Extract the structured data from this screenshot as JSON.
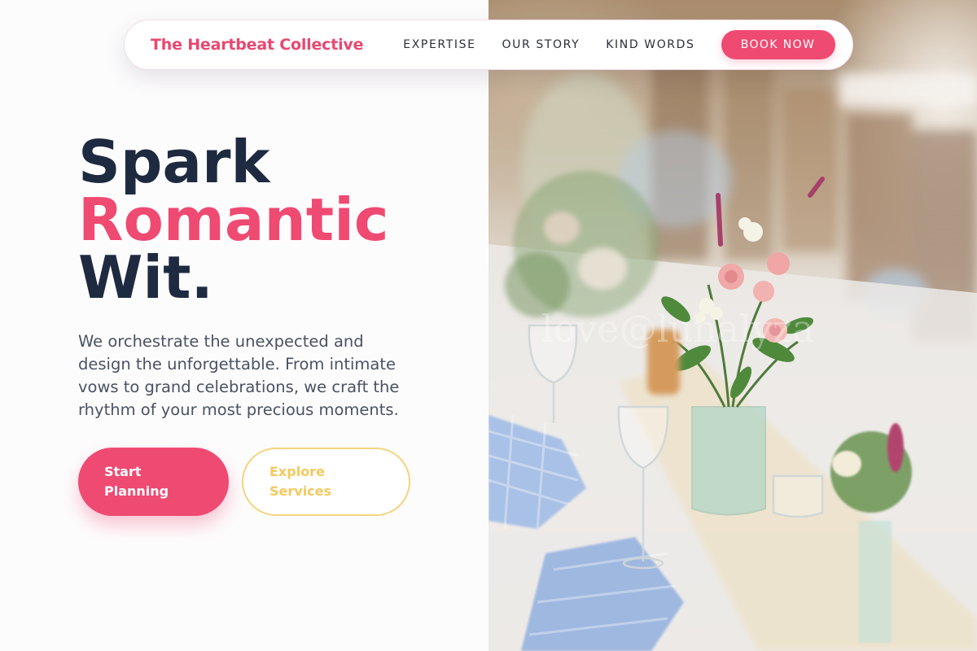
{
  "nav": {
    "brand": "The Heartbeat Collective",
    "links": [
      "EXPERTISE",
      "OUR STORY",
      "KIND WORDS"
    ],
    "cta_label": "BOOK NOW"
  },
  "hero": {
    "title_lines": [
      "Spark",
      "Romantic",
      "Wit."
    ],
    "description": "We orchestrate the unexpected and design the unforgettable. From intimate vows to grand celebrations, we craft the rhythm of your most precious moments.",
    "primary_button": "Start Planning",
    "secondary_button": "Explore Services"
  },
  "colors": {
    "accent": "#ef4a72",
    "heading": "#1e2a40",
    "secondary_accent": "#f4c95d",
    "body_text": "#4a5263"
  },
  "image": {
    "subject": "wedding-reception-table-with-floral-arrangements"
  }
}
